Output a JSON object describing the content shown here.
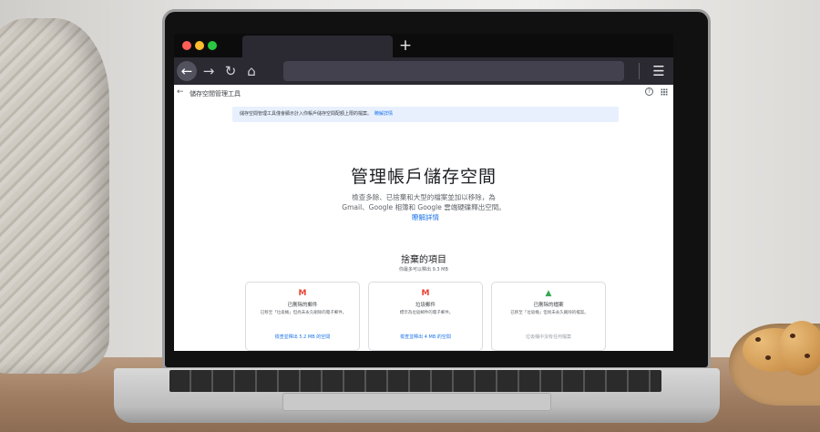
{
  "browser": {
    "new_tab_symbol": "+",
    "back_symbol": "←",
    "forward_symbol": "→",
    "reload_symbol": "↻",
    "home_symbol": "⌂",
    "menu_symbol": "☰",
    "traffic_lights": [
      "#ff5f57",
      "#febc2e",
      "#28c840"
    ]
  },
  "header": {
    "back_symbol": "←",
    "title": "儲存空間管理工具",
    "help_symbol": "?"
  },
  "banner": {
    "text": "儲存空間管理工具僅會顯示計入你帳戶儲存空間配額上限的檔案。",
    "link": "瞭解詳情"
  },
  "hero": {
    "title": "管理帳戶儲存空間",
    "description": "檢查多餘、已捨棄和大型的檔案並加以移除，為 Gmail、Google 相簿和 Google 雲端硬碟釋出空間。",
    "link": "瞭解詳情"
  },
  "discarded": {
    "title": "捨棄的項目",
    "subtitle": "你最多可以釋出 9.3 MB",
    "cards": [
      {
        "icon": "gmail-icon",
        "icon_glyph": "M",
        "title": "已刪除的郵件",
        "description": "已移至「垃圾桶」但尚未永久刪除的電子郵件。",
        "action": "檢查並釋出 5.2 MB 的空間"
      },
      {
        "icon": "gmail-icon",
        "icon_glyph": "M",
        "title": "垃圾郵件",
        "description": "標示為垃圾郵件的電子郵件。",
        "action": "檢查並釋出 4 MB 的空間"
      },
      {
        "icon": "drive-icon",
        "icon_glyph": "▲",
        "title": "已刪除的檔案",
        "description": "已移至「垃圾桶」但尚未永久刪除的檔案。",
        "action": "垃圾桶中沒有任何檔案"
      }
    ]
  }
}
